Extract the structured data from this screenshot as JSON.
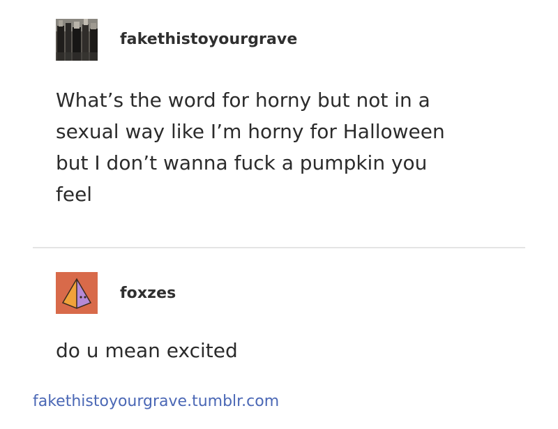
{
  "posts": [
    {
      "username": "fakethistoyourgrave",
      "avatar_icon": "photo-avatar-icon",
      "lines": [
        "What’s the word for horny but not in a",
        "sexual way like I’m horny for Halloween",
        "but I don’t wanna fuck a pumpkin you",
        "feel"
      ]
    },
    {
      "username": "foxzes",
      "avatar_icon": "pyramid-avatar-icon",
      "lines": [
        "do u mean excited"
      ]
    }
  ],
  "footer": {
    "link": "fakethistoyourgrave.tumblr.com"
  },
  "colors": {
    "text": "#2b2b2b",
    "link": "#4a67b5",
    "divider": "#e4e4e4",
    "avatar2_bg": "#d86a4a"
  }
}
